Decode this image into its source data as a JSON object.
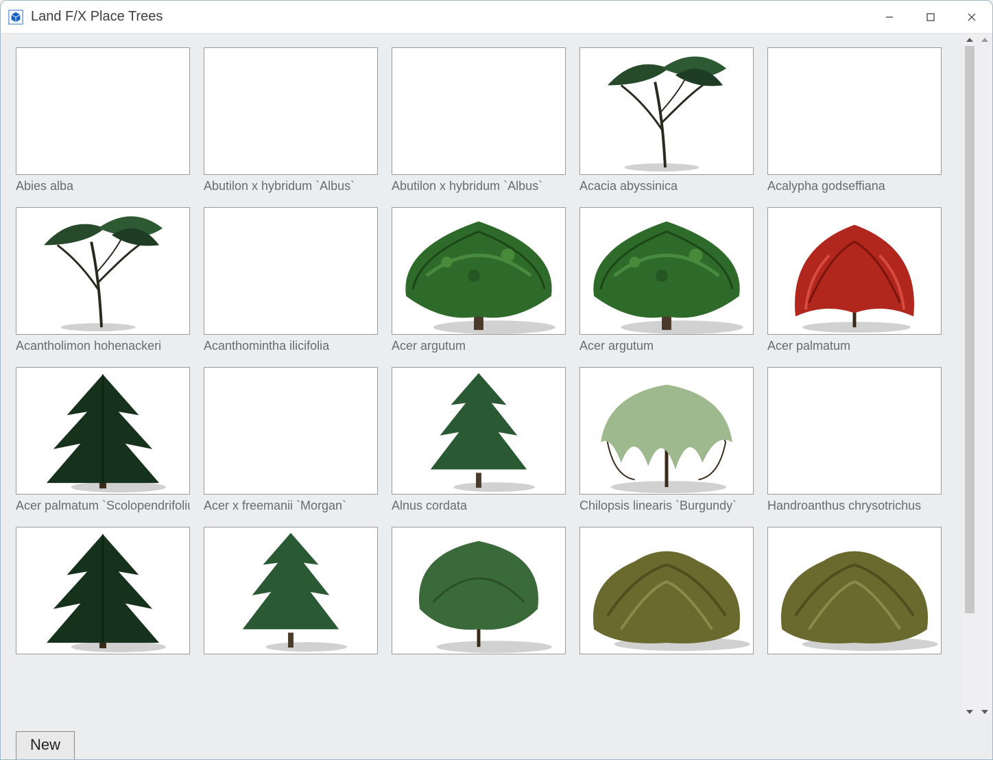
{
  "window": {
    "title": "Land F/X Place Trees"
  },
  "buttons": {
    "new": "New"
  },
  "trees": [
    {
      "name": "Abies alba",
      "art": "blank"
    },
    {
      "name": "Abutilon x hybridum `Albus`",
      "art": "blank"
    },
    {
      "name": "Abutilon x hybridum `Albus`",
      "art": "blank"
    },
    {
      "name": "Acacia abyssinica",
      "art": "acacia"
    },
    {
      "name": "Acalypha godseffiana",
      "art": "blank"
    },
    {
      "name": "Acantholimon hohenackeri",
      "art": "acacia"
    },
    {
      "name": "Acanthomintha ilicifolia",
      "art": "blank"
    },
    {
      "name": "Acer argutum",
      "art": "broad-green"
    },
    {
      "name": "Acer argutum",
      "art": "broad-green"
    },
    {
      "name": "Acer palmatum",
      "art": "maple-red"
    },
    {
      "name": "Acer palmatum `Scolopendrifolium`",
      "art": "conifer-dark"
    },
    {
      "name": "Acer x freemanii `Morgan`",
      "art": "blank"
    },
    {
      "name": "Alnus cordata",
      "art": "conifer-mid"
    },
    {
      "name": "Chilopsis linearis `Burgundy`",
      "art": "weeping-light"
    },
    {
      "name": "Handroanthus chrysotrichus",
      "art": "blank"
    },
    {
      "name": "",
      "art": "conifer-dark"
    },
    {
      "name": "",
      "art": "conifer-mid"
    },
    {
      "name": "",
      "art": "rounded-green"
    },
    {
      "name": "",
      "art": "bush-olive"
    },
    {
      "name": "",
      "art": "bush-olive"
    }
  ]
}
